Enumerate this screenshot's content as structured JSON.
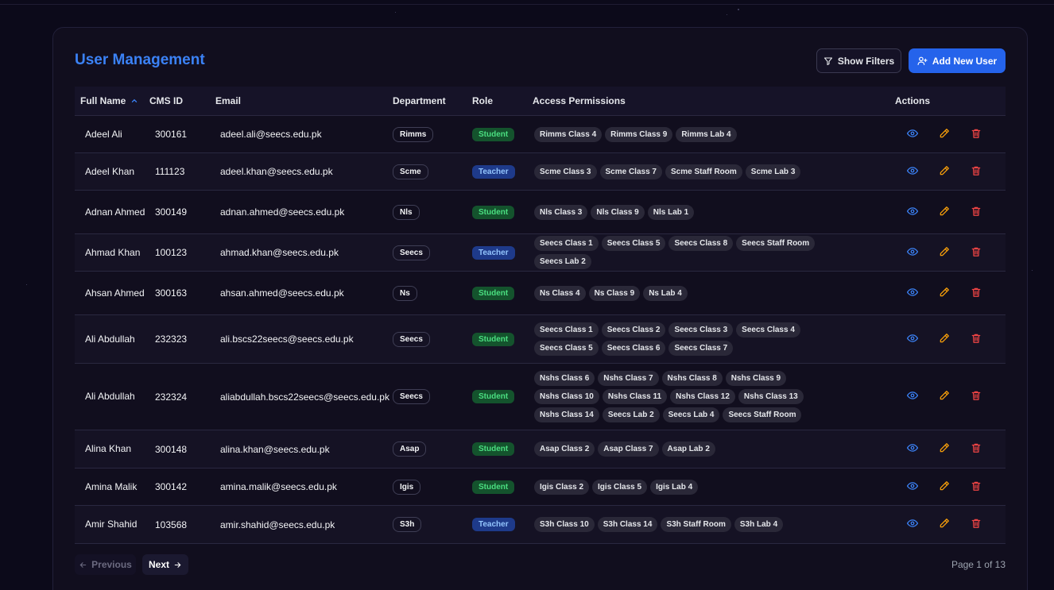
{
  "header": {
    "title": "User Management",
    "show_filters_label": "Show Filters",
    "add_user_label": "Add New User"
  },
  "columns": {
    "full_name": "Full Name",
    "cms_id": "CMS ID",
    "email": "Email",
    "department": "Department",
    "role": "Role",
    "access": "Access Permissions",
    "actions": "Actions"
  },
  "sort": {
    "column": "Full Name",
    "direction": "ascending",
    "icon": "chevron-up-icon"
  },
  "rows": [
    {
      "name": "Adeel Ali",
      "cms": "300161",
      "email": "adeel.ali@seecs.edu.pk",
      "dept": "Rimms",
      "role": "Student",
      "perms": [
        "Rimms Class 4",
        "Rimms Class 9",
        "Rimms Lab 4"
      ]
    },
    {
      "name": "Adeel Khan",
      "cms": "111123",
      "email": "adeel.khan@seecs.edu.pk",
      "dept": "Scme",
      "role": "Teacher",
      "perms": [
        "Scme Class 3",
        "Scme Class 7",
        "Scme Staff Room",
        "Scme Lab 3"
      ]
    },
    {
      "name": "Adnan Ahmed",
      "cms": "300149",
      "email": "adnan.ahmed@seecs.edu.pk",
      "dept": "Nls",
      "role": "Student",
      "perms": [
        "Nls Class 3",
        "Nls Class 9",
        "Nls Lab 1"
      ]
    },
    {
      "name": "Ahmad Khan",
      "cms": "100123",
      "email": "ahmad.khan@seecs.edu.pk",
      "dept": "Seecs",
      "role": "Teacher",
      "perms": [
        "Seecs Class 1",
        "Seecs Class 5",
        "Seecs Class 8",
        "Seecs Staff Room",
        "Seecs Lab 2"
      ]
    },
    {
      "name": "Ahsan Ahmed",
      "cms": "300163",
      "email": "ahsan.ahmed@seecs.edu.pk",
      "dept": "Ns",
      "role": "Student",
      "perms": [
        "Ns Class 4",
        "Ns Class 9",
        "Ns Lab 4"
      ]
    },
    {
      "name": "Ali Abdullah",
      "cms": "232323",
      "email": "ali.bscs22seecs@seecs.edu.pk",
      "dept": "Seecs",
      "role": "Student",
      "perms": [
        "Seecs Class 1",
        "Seecs Class 2",
        "Seecs Class 3",
        "Seecs Class 4",
        "Seecs Class 5",
        "Seecs Class 6",
        "Seecs Class 7"
      ]
    },
    {
      "name": "Ali Abdullah",
      "cms": "232324",
      "email": "aliabdullah.bscs22seecs@seecs.edu.pk",
      "dept": "Seecs",
      "role": "Student",
      "perms": [
        "Nshs Class 6",
        "Nshs Class 7",
        "Nshs Class 8",
        "Nshs Class 9",
        "Nshs Class 10",
        "Nshs Class 11",
        "Nshs Class 12",
        "Nshs Class 13",
        "Nshs Class 14",
        "Seecs Lab 2",
        "Seecs Lab 4",
        "Seecs Staff Room"
      ]
    },
    {
      "name": "Alina Khan",
      "cms": "300148",
      "email": "alina.khan@seecs.edu.pk",
      "dept": "Asap",
      "role": "Student",
      "perms": [
        "Asap Class 2",
        "Asap Class 7",
        "Asap Lab 2"
      ]
    },
    {
      "name": "Amina Malik",
      "cms": "300142",
      "email": "amina.malik@seecs.edu.pk",
      "dept": "Igis",
      "role": "Student",
      "perms": [
        "Igis Class 2",
        "Igis Class 5",
        "Igis Lab 4"
      ]
    },
    {
      "name": "Amir Shahid",
      "cms": "103568",
      "email": "amir.shahid@seecs.edu.pk",
      "dept": "S3h",
      "role": "Teacher",
      "perms": [
        "S3h Class 10",
        "S3h Class 14",
        "S3h Staff Room",
        "S3h Lab 4"
      ]
    }
  ],
  "pagination": {
    "previous_label": "Previous",
    "next_label": "Next",
    "page_info": "Page 1 of 13"
  },
  "colors": {
    "accent": "#2563eb",
    "title": "#3b82f6",
    "view_icon": "#3b82f6",
    "edit_icon": "#f59e0b",
    "delete_icon": "#ef4444",
    "student_badge": "#14532d",
    "teacher_badge": "#1e3a8a"
  }
}
